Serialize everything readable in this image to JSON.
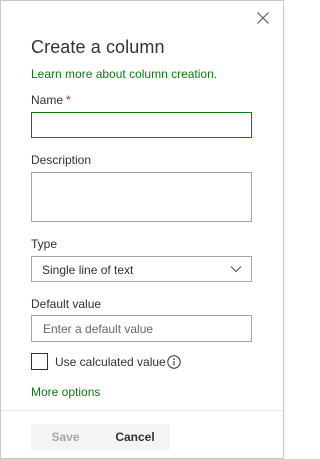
{
  "panel": {
    "title": "Create a column",
    "learn_more_link": "Learn more about column creation."
  },
  "icons": {
    "close": "close-icon",
    "chevron": "chevron-down-icon",
    "info": "info-icon"
  },
  "fields": {
    "name": {
      "label": "Name",
      "required_mark": "*",
      "value": ""
    },
    "description": {
      "label": "Description",
      "value": ""
    },
    "type": {
      "label": "Type",
      "selected": "Single line of text"
    },
    "default_value": {
      "label": "Default value",
      "placeholder": "Enter a default value",
      "value": ""
    },
    "use_calculated": {
      "label": "Use calculated value",
      "checked": false
    }
  },
  "more_options_link": "More options",
  "footer": {
    "save_label": "Save",
    "cancel_label": "Cancel"
  },
  "colors": {
    "accent": "#107c10",
    "required": "#a4262c",
    "text": "#323130",
    "border": "#a6a6a6",
    "button_bg": "#f4f4f4",
    "disabled_text": "#a6a6a6"
  }
}
